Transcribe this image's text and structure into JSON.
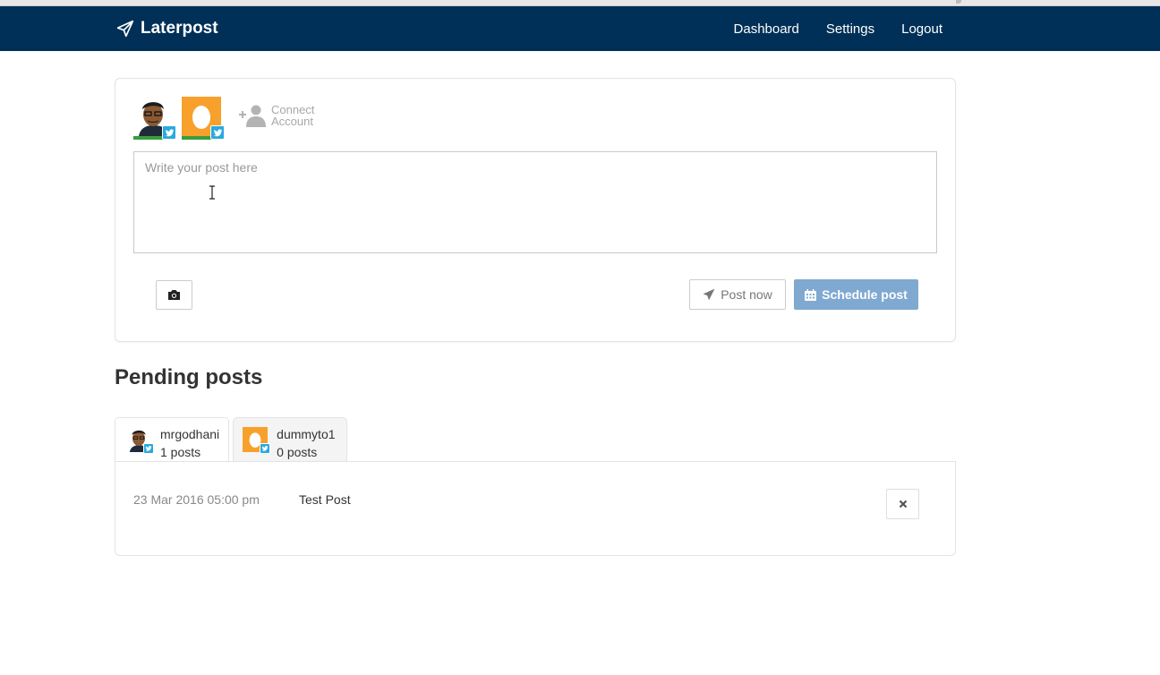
{
  "navbar": {
    "brand": "Laterpost",
    "links": [
      "Dashboard",
      "Settings",
      "Logout"
    ]
  },
  "composer": {
    "accounts": [
      {
        "name": "mrgodhani",
        "network": "twitter-icon"
      },
      {
        "name": "dummyto1",
        "network": "twitter-icon"
      }
    ],
    "connect_label_line1": "Connect",
    "connect_label_line2": "Account",
    "textarea_placeholder": "Write your post here",
    "textarea_value": "",
    "post_now_label": "Post now",
    "schedule_label": "Schedule post"
  },
  "pending": {
    "title": "Pending posts",
    "tabs": [
      {
        "username": "mrgodhani",
        "count_label": "1 posts",
        "active": true
      },
      {
        "username": "dummyto1",
        "count_label": "0 posts",
        "active": false
      }
    ],
    "posts": [
      {
        "date": "23 Mar 2016 05:00 pm",
        "text": "Test Post"
      }
    ]
  },
  "colors": {
    "navbar": "#003057",
    "schedule_button": "#7fa9d0",
    "twitter_badge": "#2aa9e0",
    "active_account_bar": "#3a9d3a",
    "egg_avatar_bg": "#f7a12c"
  }
}
